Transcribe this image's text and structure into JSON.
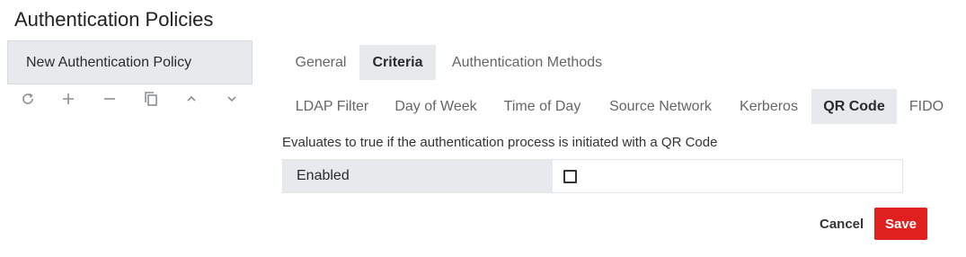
{
  "page": {
    "title": "Authentication Policies"
  },
  "policies": {
    "items": [
      {
        "label": "New Authentication Policy"
      }
    ]
  },
  "tabs": [
    {
      "label": "General"
    },
    {
      "label": "Criteria",
      "active": true
    },
    {
      "label": "Authentication Methods"
    }
  ],
  "criteria_tabs": [
    {
      "label": "LDAP Filter"
    },
    {
      "label": "Day of Week"
    },
    {
      "label": "Time of Day"
    },
    {
      "label": "Source Network"
    },
    {
      "label": "Kerberos"
    },
    {
      "label": "QR Code",
      "active": true
    },
    {
      "label": "FIDO"
    }
  ],
  "criteria": {
    "description": "Evaluates to true if the authentication process is initiated with a QR Code",
    "enabled_label": "Enabled",
    "enabled": false
  },
  "actions": {
    "cancel_label": "Cancel",
    "save_label": "Save"
  },
  "colors": {
    "accent": "#e0201e",
    "panel": "#e7eaed",
    "icon": "#8a8f94"
  },
  "icons": [
    "refresh-icon",
    "plus-icon",
    "minus-icon",
    "copy-icon",
    "chevron-up-icon",
    "chevron-down-icon"
  ]
}
